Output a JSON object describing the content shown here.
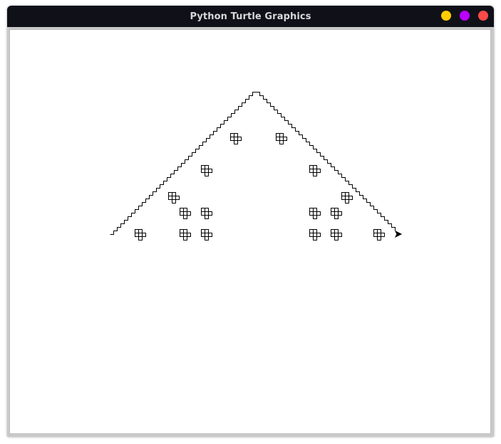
{
  "window": {
    "title": "Python Turtle Graphics",
    "controls": [
      {
        "name": "minimize-button",
        "color": "#ffcc00"
      },
      {
        "name": "maximize-button",
        "color": "#bb00ff"
      },
      {
        "name": "close-button",
        "color": "#ff4a4a"
      }
    ]
  },
  "canvas": {
    "background": "#ffffff",
    "pen_color": "#000000",
    "cursor_icon": "turtle-arrow-icon"
  }
}
